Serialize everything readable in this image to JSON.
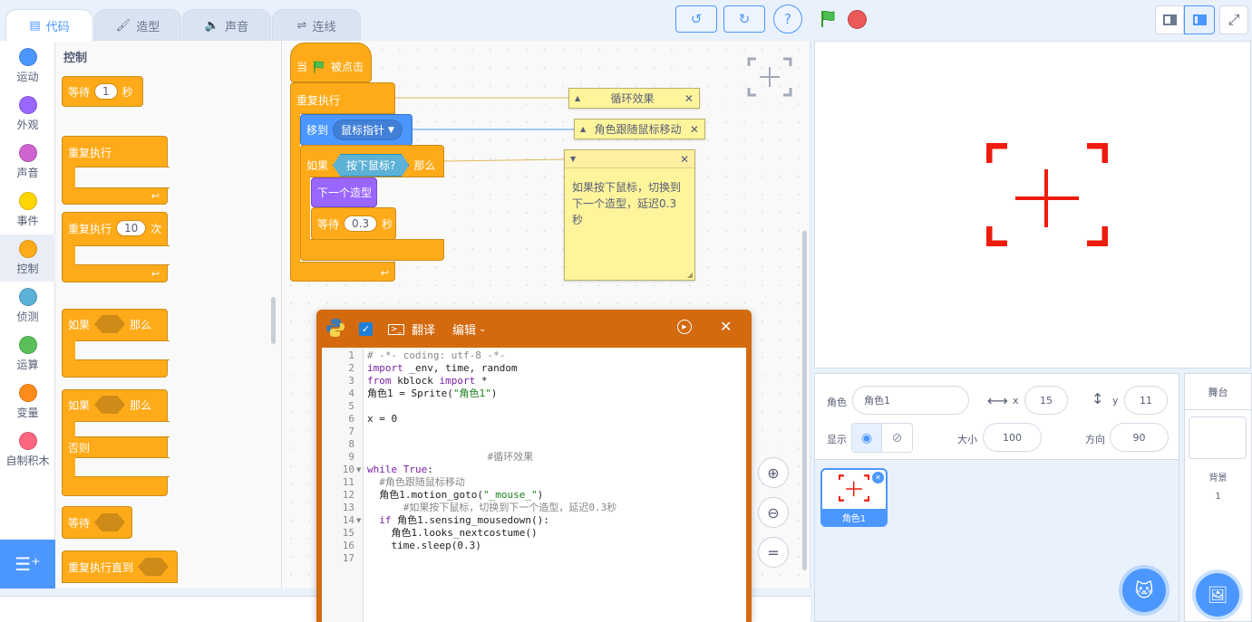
{
  "tabs": [
    {
      "label": "代码",
      "icon": "code-icon"
    },
    {
      "label": "造型",
      "icon": "brush-icon"
    },
    {
      "label": "声音",
      "icon": "speaker-icon"
    },
    {
      "label": "连线",
      "icon": "connect-icon"
    }
  ],
  "toolbar": {
    "undo": "↺",
    "redo": "↻",
    "help": "?"
  },
  "categories": [
    {
      "label": "运动",
      "color": "#4c97ff"
    },
    {
      "label": "外观",
      "color": "#9966ff"
    },
    {
      "label": "声音",
      "color": "#cf63cf"
    },
    {
      "label": "事件",
      "color": "#ffd500"
    },
    {
      "label": "控制",
      "color": "#ffab19"
    },
    {
      "label": "侦测",
      "color": "#5cb1d6"
    },
    {
      "label": "运算",
      "color": "#59c059"
    },
    {
      "label": "变量",
      "color": "#ff8c1a"
    },
    {
      "label": "自制积木",
      "color": "#ff6680"
    }
  ],
  "palette": {
    "title": "控制",
    "wait_label": "等待",
    "wait_value": "1",
    "wait_unit": "秒",
    "forever_label": "重复执行",
    "repeat_label": "重复执行",
    "repeat_value": "10",
    "repeat_unit": "次",
    "if_label": "如果",
    "if_then": "那么",
    "ifelse_label": "如果",
    "ifelse_then": "那么",
    "ifelse_else": "否则",
    "waituntil_label": "等待",
    "repeatuntil_label": "重复执行直到"
  },
  "script": {
    "hat_when": "当",
    "hat_clicked": "被点击",
    "forever": "重复执行",
    "goto": "移到",
    "goto_target": "鼠标指针",
    "if": "如果",
    "condition": "按下鼠标?",
    "then": "那么",
    "next_costume": "下一个造型",
    "wait": "等待",
    "wait_value": "0.3",
    "wait_unit": "秒"
  },
  "comments": {
    "loop": "循环效果",
    "follow": "角色跟随鼠标移动",
    "click_body": "如果按下鼠标，切换到下一个造型，延迟0.3秒"
  },
  "codewin": {
    "translate": "翻译",
    "edit": "编辑",
    "lines": [
      "# -*- coding: utf-8 -*-",
      "import _env, time, random",
      "from kblock import *",
      "角色1 = Sprite(\"角色1\")",
      "",
      "x = 0",
      "",
      "",
      "                    #循环效果",
      "while True:",
      "  #角色跟随鼠标移动",
      "  角色1.motion_goto(\"_mouse_\")",
      "      #如果按下鼠标，切换到下一个造型，延迟0.3秒",
      "  if 角色1.sensing_mousedown():",
      "    角色1.looks_nextcostume()",
      "    time.sleep(0.3)",
      ""
    ]
  },
  "sprite": {
    "label_sprite": "角色",
    "name": "角色1",
    "label_x": "x",
    "x": "15",
    "label_y": "y",
    "y": "11",
    "label_show": "显示",
    "label_size": "大小",
    "size": "100",
    "label_direction": "方向",
    "direction": "90",
    "thumb_name": "角色1"
  },
  "stage_pane": {
    "title": "舞台",
    "backdrop_label": "背景",
    "backdrop_count": "1"
  },
  "zoom": {
    "in": "+",
    "out": "−",
    "reset": "="
  }
}
